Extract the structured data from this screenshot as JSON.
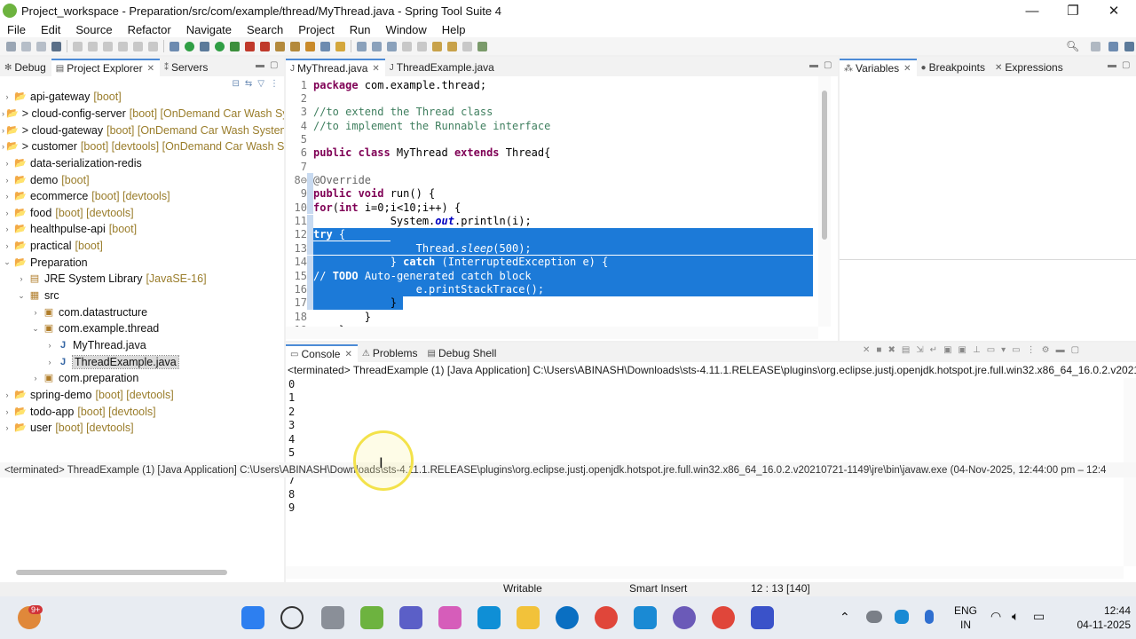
{
  "window": {
    "title": "Project_workspace - Preparation/src/com/example/thread/MyThread.java - Spring Tool Suite 4",
    "minimize": "—",
    "maximize": "❐",
    "close": "✕"
  },
  "menu": [
    "File",
    "Edit",
    "Source",
    "Refactor",
    "Navigate",
    "Search",
    "Project",
    "Run",
    "Window",
    "Help"
  ],
  "left_tabs": [
    "Debug",
    "Project Explorer",
    "Servers"
  ],
  "tree": [
    {
      "arrow": "›",
      "name": "api-gateway",
      "deco": "[boot]",
      "indent": 0,
      "icon": "📂"
    },
    {
      "arrow": "›",
      "name": "> cloud-config-server",
      "deco": "[boot] [OnDemand Car Wash Sy",
      "indent": 0,
      "icon": "📂"
    },
    {
      "arrow": "›",
      "name": "> cloud-gateway",
      "deco": "[boot] [OnDemand Car Wash System",
      "indent": 0,
      "icon": "📂"
    },
    {
      "arrow": "›",
      "name": "> customer",
      "deco": "[boot] [devtools] [OnDemand Car Wash Sy",
      "indent": 0,
      "icon": "📂"
    },
    {
      "arrow": "›",
      "name": "data-serialization-redis",
      "deco": "",
      "indent": 0,
      "icon": "📂"
    },
    {
      "arrow": "›",
      "name": "demo",
      "deco": "[boot]",
      "indent": 0,
      "icon": "📂"
    },
    {
      "arrow": "›",
      "name": "ecommerce",
      "deco": "[boot] [devtools]",
      "indent": 0,
      "icon": "📂"
    },
    {
      "arrow": "›",
      "name": "food",
      "deco": "[boot] [devtools]",
      "indent": 0,
      "icon": "📂"
    },
    {
      "arrow": "›",
      "name": "healthpulse-api",
      "deco": "[boot]",
      "indent": 0,
      "icon": "📂"
    },
    {
      "arrow": "›",
      "name": "practical",
      "deco": "[boot]",
      "indent": 0,
      "icon": "📂"
    },
    {
      "arrow": "⌄",
      "name": "Preparation",
      "deco": "",
      "indent": 0,
      "icon": "📂"
    },
    {
      "arrow": "›",
      "name": "JRE System Library",
      "deco": "[JavaSE-16]",
      "indent": 1,
      "icon": "▤"
    },
    {
      "arrow": "⌄",
      "name": "src",
      "deco": "",
      "indent": 1,
      "icon": "▦"
    },
    {
      "arrow": "›",
      "name": "com.datastructure",
      "deco": "",
      "indent": 2,
      "icon": "▣"
    },
    {
      "arrow": "⌄",
      "name": "com.example.thread",
      "deco": "",
      "indent": 2,
      "icon": "▣"
    },
    {
      "arrow": "›",
      "name": "MyThread.java",
      "deco": "",
      "indent": 3,
      "icon": "J"
    },
    {
      "arrow": "›",
      "name": "ThreadExample.java",
      "deco": "",
      "indent": 3,
      "icon": "J",
      "selected": true
    },
    {
      "arrow": "›",
      "name": "com.preparation",
      "deco": "",
      "indent": 2,
      "icon": "▣"
    },
    {
      "arrow": "›",
      "name": "spring-demo",
      "deco": "[boot] [devtools]",
      "indent": 0,
      "icon": "📂"
    },
    {
      "arrow": "›",
      "name": "todo-app",
      "deco": "[boot] [devtools]",
      "indent": 0,
      "icon": "📂"
    },
    {
      "arrow": "›",
      "name": "user",
      "deco": "[boot] [devtools]",
      "indent": 0,
      "icon": "📂"
    }
  ],
  "editor_tabs": [
    "MyThread.java",
    "ThreadExample.java"
  ],
  "code_lines": [
    {
      "n": "1",
      "html": "<span class=\"kw\">package</span> com.example.thread;"
    },
    {
      "n": "2",
      "html": ""
    },
    {
      "n": "3",
      "html": "<span class=\"cm\">//to extend the Thread class</span>"
    },
    {
      "n": "4",
      "html": "<span class=\"cm\">//to implement the Runnable interface</span>"
    },
    {
      "n": "5",
      "html": ""
    },
    {
      "n": "6",
      "html": "<span class=\"kw\">public class</span> MyThread <span class=\"kw\">extends</span> Thread{"
    },
    {
      "n": "7",
      "html": ""
    },
    {
      "n": "8⊖",
      "html": "    <span class=\"ann\">@Override</span>"
    },
    {
      "n": "9",
      "html": "    <span class=\"kw\">public void</span> run() {"
    },
    {
      "n": "10",
      "html": "        <span class=\"kw\">for</span>(<span class=\"kw\">int</span> i=0;i&lt;10;i++) {"
    },
    {
      "n": "11",
      "html": "            System.<span class=\"it\" style=\"color:#0000c0;font-weight:bold\">out</span>.println(i);"
    },
    {
      "n": "12",
      "html": "            <span class=\"sel\"><span class=\"kw\">try</span> {                                                 </span>",
      "sel": "partial"
    },
    {
      "n": "13",
      "html": "                Thread.<span class=\"it\">sleep</span>(500);",
      "sel": "full"
    },
    {
      "n": "14",
      "html": "            } <span class=\"kw\">catch</span> (InterruptedException e) {",
      "sel": "full"
    },
    {
      "n": "15",
      "html": "                <span class=\"cm\">// <b>TODO</b> Auto-generated catch block</span>",
      "sel": "full"
    },
    {
      "n": "16",
      "html": "                e.printStackTrace();",
      "sel": "full"
    },
    {
      "n": "17",
      "html": "            }",
      "sel": "end"
    },
    {
      "n": "18",
      "html": "        }"
    },
    {
      "n": "19",
      "html": "    }"
    }
  ],
  "right_tabs": [
    "Variables",
    "Breakpoints",
    "Expressions"
  ],
  "console_tabs": [
    "Console",
    "Problems",
    "Debug Shell"
  ],
  "console_header": "<terminated> ThreadExample (1) [Java Application] C:\\Users\\ABINASH\\Downloads\\sts-4.11.1.RELEASE\\plugins\\org.eclipse.justj.openjdk.hotspot.jre.full.win32.x86_64_16.0.2.v2021072",
  "console_output": [
    "0",
    "1",
    "2",
    "3",
    "4",
    "5",
    "",
    "7",
    "8",
    "9"
  ],
  "tooltip": "<terminated> ThreadExample (1) [Java Application] C:\\Users\\ABINASH\\Downloads\\sts-4.11.1.RELEASE\\plugins\\org.eclipse.justj.openjdk.hotspot.jre.full.win32.x86_64_16.0.2.v20210721-1149\\jre\\bin\\javaw.exe  (04-Nov-2025, 12:44:00 pm – 12:4",
  "status": {
    "writable": "Writable",
    "insert": "Smart Insert",
    "position": "12 : 13 [140]"
  },
  "taskbar": {
    "badge": "9+",
    "lang_top": "ENG",
    "lang_bottom": "IN",
    "time": "12:44",
    "date": "04-11-2025"
  },
  "colors": {
    "accent": "#1c7ad8",
    "keyword": "#7f0055",
    "comment": "#3f7f5f",
    "decoration": "#9a7d2b"
  }
}
